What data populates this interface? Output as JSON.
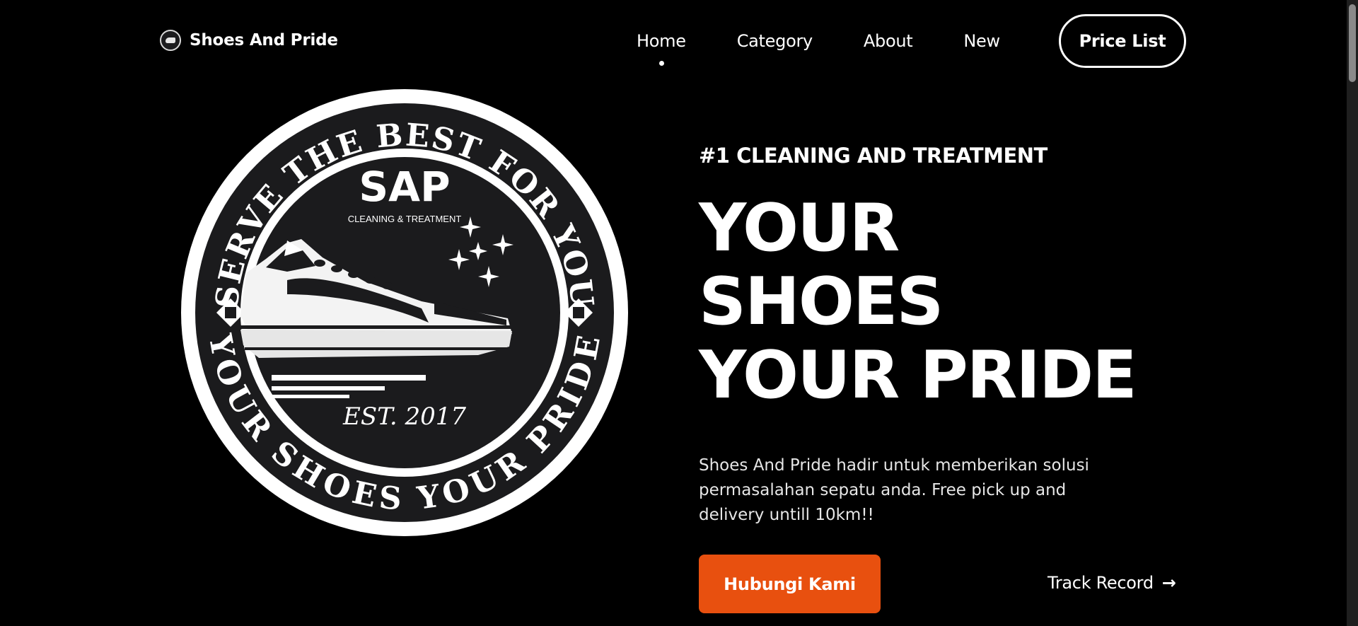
{
  "brand": {
    "name": "Shoes And Pride",
    "logo_icon": "sap-badge-icon"
  },
  "nav": {
    "links": [
      {
        "label": "Home",
        "active": true
      },
      {
        "label": "Category",
        "active": false
      },
      {
        "label": "About",
        "active": false
      },
      {
        "label": "New",
        "active": false
      }
    ],
    "price_button": "Price List"
  },
  "logo": {
    "top_ring_text": "SERVE THE BEST FOR YOU",
    "bottom_ring_text": "YOUR SHOES YOUR PRIDE",
    "name": "SAP",
    "subtitle": "CLEANING & TREATMENT",
    "est": "EST. 2017"
  },
  "hero": {
    "tagline": "#1 CLEANING AND TREATMENT",
    "headline": [
      "YOUR",
      "SHOES",
      "YOUR PRIDE"
    ],
    "description": "Shoes And Pride hadir untuk memberikan solusi permasalahan sepatu anda. Free pick up and delivery untill 10km!!",
    "cta_label": "Hubungi Kami",
    "track_label": "Track Record",
    "track_icon": "arrow-right-icon"
  },
  "colors": {
    "background": "#000000",
    "accent": "#e8500f",
    "text": "#ffffff"
  }
}
